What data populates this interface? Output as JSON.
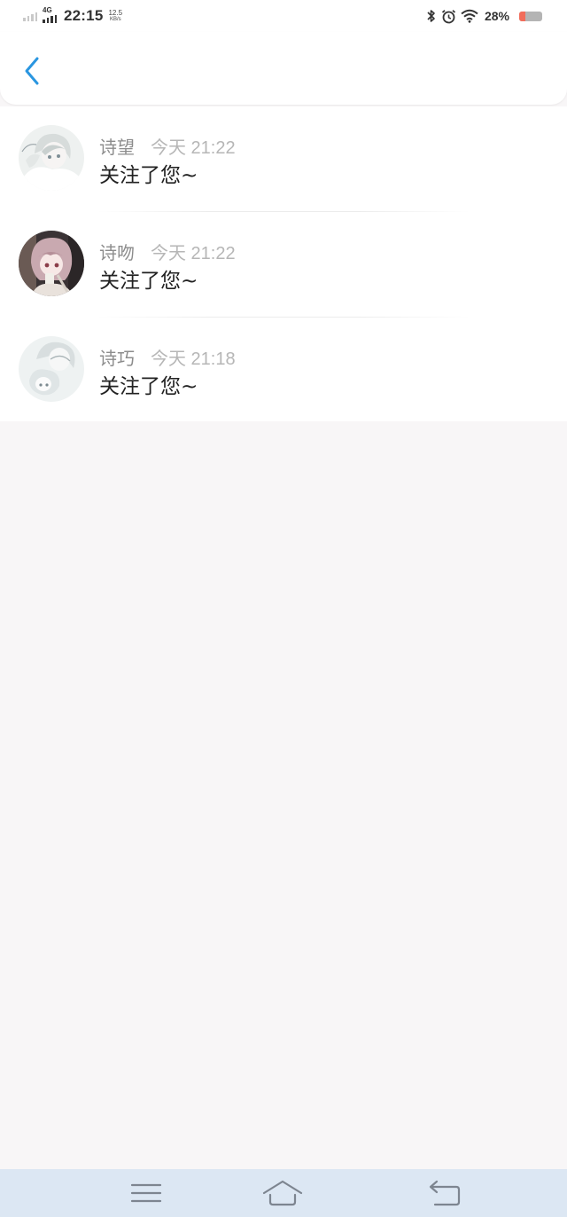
{
  "status_bar": {
    "network_type": "4G",
    "time": "22:15",
    "net_speed_value": "12.5",
    "net_speed_unit": "KB/s",
    "battery_percent": "28%",
    "battery_level": 0.28,
    "icons": [
      "signal-sim1-icon",
      "signal-4g-icon",
      "bluetooth-icon",
      "alarm-icon",
      "wifi-icon",
      "battery-icon"
    ]
  },
  "header": {
    "back_icon": "chevron-left-icon",
    "accent_color": "#2a96e0"
  },
  "notifications": [
    {
      "username": "诗望",
      "time": "今天 21:22",
      "message": "关注了您~"
    },
    {
      "username": "诗吻",
      "time": "今天 21:22",
      "message": "关注了您~"
    },
    {
      "username": "诗巧",
      "time": "今天 21:18",
      "message": "关注了您~"
    }
  ],
  "nav_bar": {
    "icons": [
      "menu-icon",
      "home-icon",
      "back-icon"
    ]
  }
}
